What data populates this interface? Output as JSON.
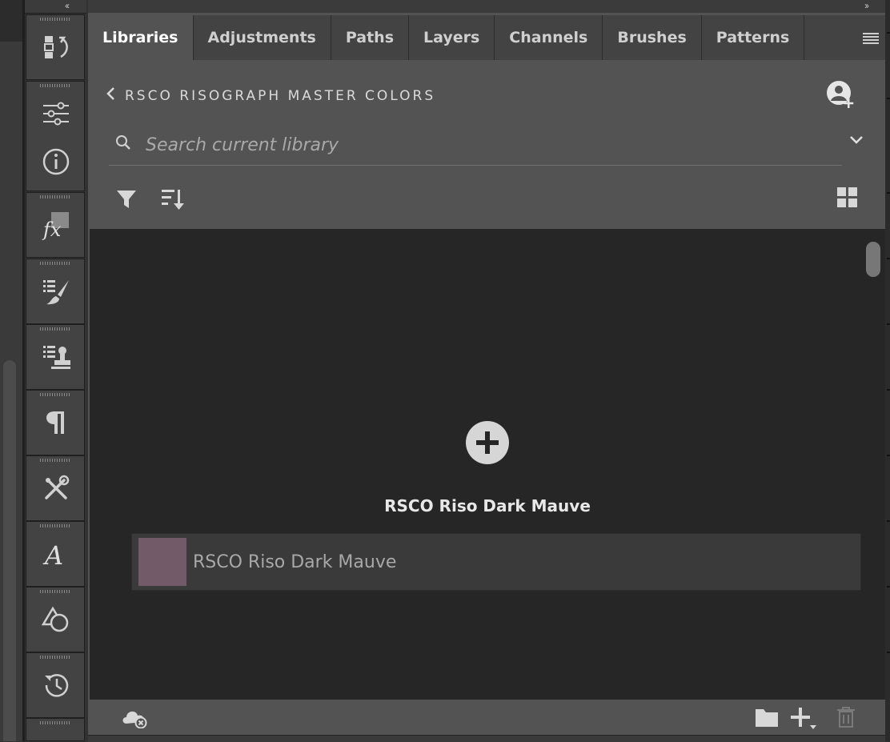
{
  "colors": {
    "swatch": "#735a68",
    "accent_text": "#ffffff",
    "panel_bg": "#535353",
    "content_bg": "#262626"
  },
  "dock": {
    "collapse_left": "‹‹",
    "collapse_right": "››",
    "tools": [
      {
        "icon": "history-brush-icon"
      },
      {
        "icon": "adjustment-sliders-icon"
      },
      {
        "icon": "info-icon"
      },
      {
        "icon": "fx-styles-icon"
      },
      {
        "icon": "brush-settings-icon"
      },
      {
        "icon": "clone-source-icon"
      },
      {
        "icon": "paragraph-icon"
      },
      {
        "icon": "tool-presets-icon"
      },
      {
        "icon": "glyphs-icon"
      },
      {
        "icon": "shapes-icon"
      },
      {
        "icon": "history-icon"
      }
    ]
  },
  "tabs": [
    {
      "label": "Libraries",
      "active": true
    },
    {
      "label": "Adjustments"
    },
    {
      "label": "Paths"
    },
    {
      "label": "Layers"
    },
    {
      "label": "Channels"
    },
    {
      "label": "Brushes"
    },
    {
      "label": "Patterns"
    }
  ],
  "library": {
    "breadcrumb": "RSCO RISOGRAPH MASTER COLORS",
    "search_placeholder": "Search current library",
    "section_title": "RSCO Riso Dark Mauve",
    "items": [
      {
        "name": "RSCO Riso Dark Mauve",
        "color": "#735a68"
      }
    ]
  },
  "footer": {
    "icons": [
      "cloud-offline-icon",
      "folder-icon",
      "add-content-icon",
      "trash-icon"
    ]
  }
}
